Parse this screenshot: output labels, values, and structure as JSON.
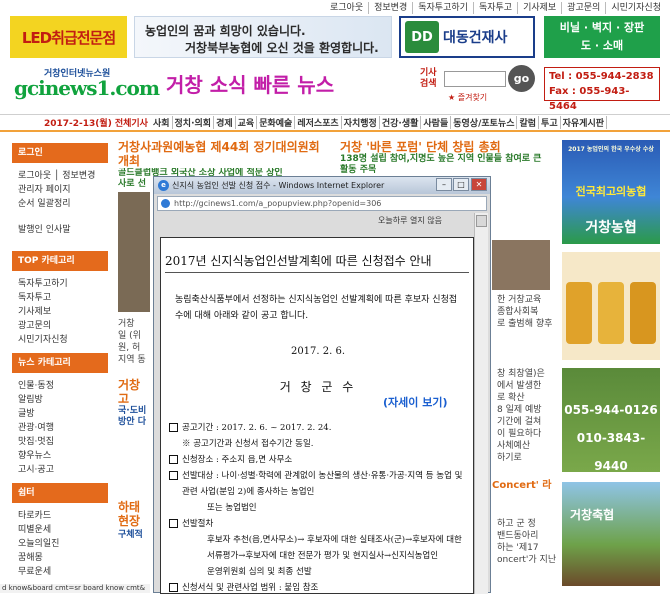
{
  "top_nav": [
    "로그아웃",
    "정보변경",
    "독자투고하기",
    "독자투고",
    "기사제보",
    "광고문의",
    "시민기자신청"
  ],
  "ads": {
    "led": "LED취급전문점",
    "farm_line1": "농업인의 꿈과 희망이 있습니다.",
    "farm_line2": "거창북부농협에 오신 것을 환영합니다.",
    "construction": "대동건재사",
    "construction_logo": "DD",
    "vinyl_line1": "비닐 · 벽지 · 장판",
    "vinyl_line2": "도 · 소매"
  },
  "site": {
    "logo_small": "거창인터넷뉴스원",
    "logo_main": "gcinews1.com",
    "tagline": "거창 소식 빠른 뉴스"
  },
  "search": {
    "label": "기사 검색",
    "button": "go",
    "bookmark": "즐겨찾기"
  },
  "contact": {
    "tel": "Tel : 055-944-2838",
    "fax": "Fax : 055-943-5464"
  },
  "menu": {
    "date": "2017-2-13(월)",
    "all": "전체기사",
    "items": [
      "사회",
      "정치·의회",
      "경제",
      "교육",
      "문화예술",
      "레저스포츠",
      "자치행정",
      "건강·생활",
      "사람들",
      "동영상/포토뉴스",
      "칼럼",
      "투고",
      "자유게시판"
    ]
  },
  "sidebar": {
    "login_head": "로그인",
    "login_items": [
      "로그아웃 │ 정보변경",
      "관리자 페이지",
      "순서 일괄정리"
    ],
    "notice": "발행인 인사말",
    "top_head": "TOP 카테고리",
    "top_items": [
      "독자투고하기",
      "독자투고",
      "기사제보",
      "광고문의",
      "시민기자신청"
    ],
    "news_head": "뉴스 카테고리",
    "news_items": [
      "인물·동정",
      "알림방",
      "글방",
      "관광·여행",
      "맛집·멋집",
      "향우뉴스",
      "고시·공고"
    ],
    "rest_head": "쉼터",
    "rest_items": [
      "타로카드",
      "띠별운세",
      "오늘의일진",
      "꿈해몽",
      "무료운세"
    ]
  },
  "articles": {
    "a1_title": "거창사과원예농협 제44회 정기대의원회 개최",
    "a1_sub": "골드클럽뱅크 외국산 소상 사업에 적문 상인",
    "a1_sub2": "사로 선",
    "r1_title": "거창 '바른 포럼' 단체 창립 총회",
    "r1_sub": "138명 설립 참여,지명도 높은 지역 인물들 참여로 큰 활동 주목",
    "mid_left": [
      "거창",
      "일 (위",
      "원, 허",
      "지역 동"
    ],
    "a2_title": "거창",
    "a2_title2": "고",
    "a2_sub": "국·도비",
    "a2_sub2": "방안 다",
    "a3_title": "하태",
    "a3_title2": "현장",
    "a3_sub": "구체적",
    "right_frag1": [
      "한 거창교육",
      "종합사회복",
      "로 출범해 향후"
    ],
    "right_frag2": [
      "창 최창열)은",
      "에서 발생한",
      "로 확산",
      "8 일제 예방",
      "기간에 걸쳐",
      "이 필요하다",
      "사체예산",
      "하기로"
    ],
    "concert": "Concert' 라",
    "right_frag3": [
      "하고 군 정",
      "밴드동아리",
      "하는 '제17",
      "oncert'가 지난"
    ]
  },
  "right_ads": {
    "ad1_line1": "2017 농업인의 한국 우수상 수상",
    "ad1_line2": "전국최고의농협",
    "ad1_line3": "거창농협",
    "phone1": "055-944-0126",
    "phone2": "010-3843-9440",
    "ad4": "거창축협"
  },
  "popup": {
    "window_title": "신지식 농업인 선발 신청 접수 - Windows Internet Explorer",
    "url": "http://gcinews1.com/a_popupview.php?openid=306",
    "no_show": "오늘하루 열지 않음",
    "doc_title": "2017년 신지식농업인선발계획에 따른 신청접수 안내",
    "intro": "농림축산식품부에서 선정하는 신지식농업인 선발계획에 따른 후보자 신청접수에 대해 아래와 같이 공고 합니다.",
    "date": "2017. 2. 6.",
    "signer": "거 창 군 수",
    "more": "(자세이 보기)",
    "items": [
      {
        "box": true,
        "text": "공고기간 : 2017. 2. 6. ~ 2017. 2. 24."
      },
      {
        "box": false,
        "text": "※ 공고기간과 신청서 접수기간 동일."
      },
      {
        "box": true,
        "text": "신청장소 : 주소지 읍,면 사무소"
      },
      {
        "box": true,
        "text": "선발대상 : 나이·성별·학력에 관계없이 농산물의 생산·유통·가공·지역 등 농업 및 관련 사업(분임 2)에 종사하는 농업인"
      },
      {
        "box": false,
        "text": "또는 농업법인",
        "sub": true
      },
      {
        "box": true,
        "text": "선발절차"
      },
      {
        "box": false,
        "text": "후보자 추천(읍,면사무소)→ 후보자에 대한 실태조사(군)→후보자에 대한 서류평가→후보자에 대한 전문가 평가 및 현지실사→신지식농업인",
        "sub": true
      },
      {
        "box": false,
        "text": "운영위원회 심의 및 최종 선발",
        "sub": true
      },
      {
        "box": true,
        "text": "신청서식 및 관련사업 범위 : 붙임 참조"
      }
    ]
  },
  "status": "d know&board cmt=sr board know cmt&"
}
